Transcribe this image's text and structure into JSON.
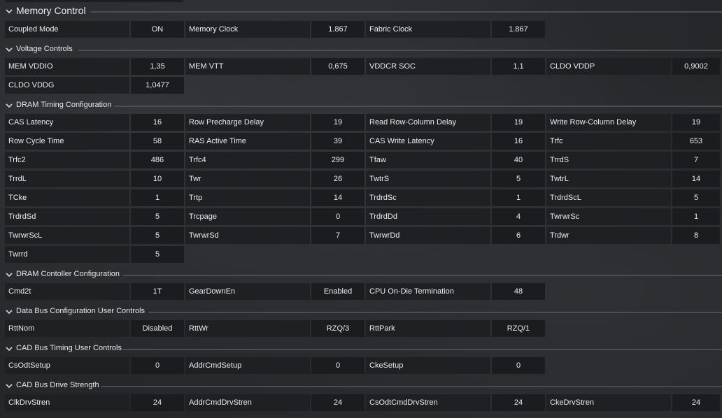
{
  "sections": {
    "memory_control": "Memory Control",
    "voltage_controls": "Voltage Controls",
    "dram_timing": "DRAM Timing Configuration",
    "dram_controller": "DRAM Contoller Configuration",
    "data_bus": "Data Bus Configuration User Controls",
    "cad_timing": "CAD Bus Timing User Controls",
    "cad_drive": "CAD Bus Drive Strength"
  },
  "memory_control": [
    {
      "label": "Coupled Mode",
      "value": "ON"
    },
    {
      "label": "Memory Clock",
      "value": "1.867"
    },
    {
      "label": "Fabric Clock",
      "value": "1.867"
    }
  ],
  "voltage": [
    {
      "label": "MEM VDDIO",
      "value": "1,35"
    },
    {
      "label": "MEM VTT",
      "value": "0,675"
    },
    {
      "label": "VDDCR SOC",
      "value": "1,1"
    },
    {
      "label": "CLDO VDDP",
      "value": "0,9002"
    },
    {
      "label": "CLDO VDDG",
      "value": "1,0477"
    }
  ],
  "timing": [
    {
      "label": "CAS Latency",
      "value": "16"
    },
    {
      "label": "Row Precharge Delay",
      "value": "19"
    },
    {
      "label": "Read Row-Column Delay",
      "value": "19"
    },
    {
      "label": "Write Row-Column Delay",
      "value": "19"
    },
    {
      "label": "Row Cycle Time",
      "value": "58"
    },
    {
      "label": "RAS Active Time",
      "value": "39"
    },
    {
      "label": "CAS Write Latency",
      "value": "16"
    },
    {
      "label": "Trfc",
      "value": "653"
    },
    {
      "label": "Trfc2",
      "value": "486"
    },
    {
      "label": "Trfc4",
      "value": "299"
    },
    {
      "label": "Tfaw",
      "value": "40"
    },
    {
      "label": "TrrdS",
      "value": "7"
    },
    {
      "label": "TrrdL",
      "value": "10"
    },
    {
      "label": "Twr",
      "value": "26"
    },
    {
      "label": "TwtrS",
      "value": "5"
    },
    {
      "label": "TwtrL",
      "value": "14"
    },
    {
      "label": "TCke",
      "value": "1"
    },
    {
      "label": "Trtp",
      "value": "14"
    },
    {
      "label": "TrdrdSc",
      "value": "1"
    },
    {
      "label": "TrdrdScL",
      "value": "5"
    },
    {
      "label": "TrdrdSd",
      "value": "5"
    },
    {
      "label": "Trcpage",
      "value": "0"
    },
    {
      "label": "TrdrdDd",
      "value": "4"
    },
    {
      "label": "TwrwrSc",
      "value": "1"
    },
    {
      "label": "TwrwrScL",
      "value": "5"
    },
    {
      "label": "TwrwrSd",
      "value": "7"
    },
    {
      "label": "TwrwrDd",
      "value": "6"
    },
    {
      "label": "Trdwr",
      "value": "8"
    },
    {
      "label": "Twrrd",
      "value": "5"
    }
  ],
  "controller": [
    {
      "label": "Cmd2t",
      "value": "1T"
    },
    {
      "label": "GearDownEn",
      "value": "Enabled"
    },
    {
      "label": "CPU On-Die Termination",
      "value": "48"
    }
  ],
  "data_bus": [
    {
      "label": "RttNom",
      "value": "Disabled"
    },
    {
      "label": "RttWr",
      "value": "RZQ/3"
    },
    {
      "label": "RttPark",
      "value": "RZQ/1"
    }
  ],
  "cad_timing": [
    {
      "label": "CsOdtSetup",
      "value": "0"
    },
    {
      "label": "AddrCmdSetup",
      "value": "0"
    },
    {
      "label": "CkeSetup",
      "value": "0"
    }
  ],
  "cad_drive": [
    {
      "label": "ClkDrvStren",
      "value": "24"
    },
    {
      "label": "AddrCmdDrvStren",
      "value": "24"
    },
    {
      "label": "CsOdtCmdDrvStren",
      "value": "24"
    },
    {
      "label": "CkeDrvStren",
      "value": "24"
    }
  ],
  "icons": {
    "section_toggle": "chevron-down-icon"
  }
}
